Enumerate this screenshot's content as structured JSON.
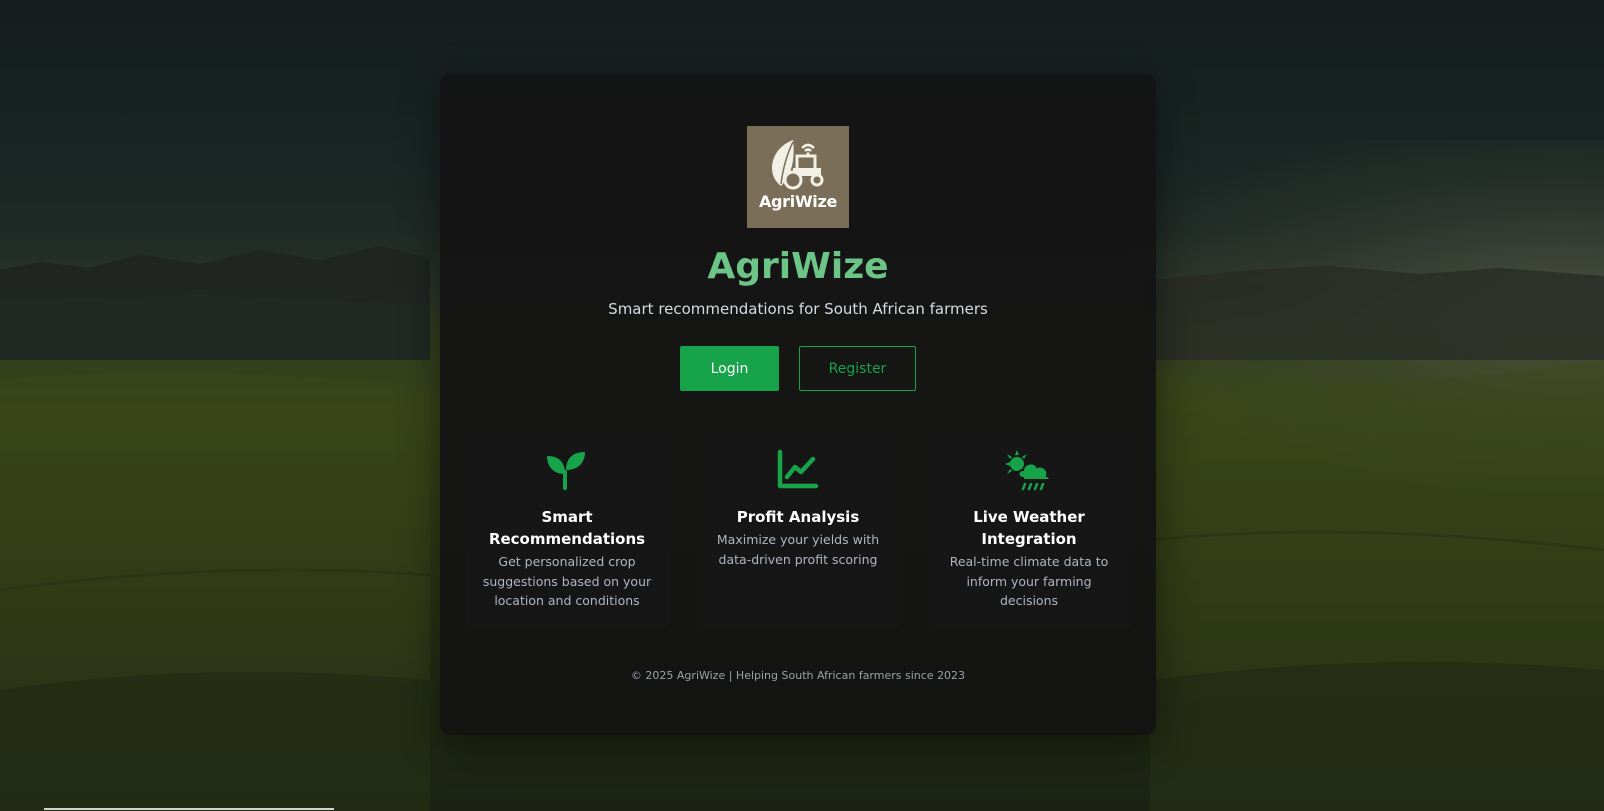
{
  "brand": {
    "logo_text": "AgriWize",
    "title": "AgriWize",
    "tagline": "Smart recommendations for South African farmers"
  },
  "auth": {
    "login_label": "Login",
    "register_label": "Register"
  },
  "features": [
    {
      "icon": "seedling-icon",
      "title": "Smart Recommendations",
      "description": "Get personalized crop suggestions based on your location and conditions"
    },
    {
      "icon": "chart-line-icon",
      "title": "Profit Analysis",
      "description": "Maximize your yields with data-driven profit scoring"
    },
    {
      "icon": "cloud-sun-rain-icon",
      "title": "Live Weather Integration",
      "description": "Real-time climate data to inform your farming decisions"
    }
  ],
  "footer": {
    "text": "© 2025 AgriWize | Helping South African farmers since 2023"
  },
  "colors": {
    "accent": "#16a34a",
    "title": "#6cc487",
    "card_bg": "#141414",
    "logo_bg": "#7a6e58"
  }
}
